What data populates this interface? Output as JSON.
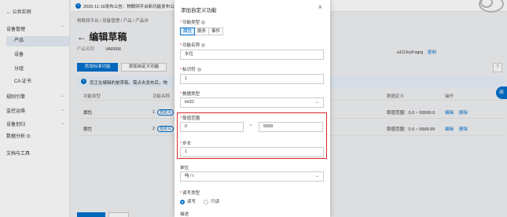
{
  "sidebar": {
    "back": "← 公共实例",
    "groups": [
      {
        "label": "设备管理",
        "items": [
          "产品",
          "设备",
          "分组",
          "CA 证书"
        ]
      },
      {
        "label": "规则引擎"
      },
      {
        "label": "监控运维"
      },
      {
        "label": "设备划归"
      },
      {
        "label": "数据分析 ⊡"
      },
      {
        "label": "文档与工具"
      }
    ]
  },
  "notice": {
    "icon": "info-icon",
    "text": "2020-11-19发布公告：物联网平台新功能发布公告，详情"
  },
  "breadcrumb": "物联网平台  /  设备管理  /  产品  /  产品详",
  "page_title": "← 编辑草稿",
  "meta": {
    "label": "产品名称",
    "value": "VAR666",
    "right_text": "a1OJoyFogrg",
    "right_link": "复制"
  },
  "buttons": {
    "add_std": "添加标准功能",
    "add_custom": "添加自定义功能"
  },
  "info_text": "您正在编辑的是草稿，需点击发布后，物",
  "table": {
    "headers": [
      "功能类型",
      "功能名称",
      "数据定义",
      "操作"
    ],
    "rows": [
      {
        "type": "属性",
        "name_prefix": "1",
        "tag": "自定义",
        "def": "取值范围：0.0 ~ 99999.0",
        "edit": "编辑",
        "delete": "删除"
      },
      {
        "type": "属性",
        "name_prefix": "2",
        "tag": "自定义",
        "def": "取值范围：0.0 ~ 9999.99",
        "edit": "编辑",
        "delete": "删除"
      }
    ]
  },
  "side_buttons": {
    "help": "?",
    "float": "⊞"
  },
  "dialog": {
    "title": "添加自定义功能",
    "close": "×",
    "fields": {
      "func_type": {
        "label": "功能类型",
        "options": [
          "属性",
          "服务",
          "事件"
        ],
        "selected": "属性"
      },
      "func_name": {
        "label": "功能名称",
        "value": "水位"
      },
      "identifier": {
        "label": "标识符",
        "value": "1"
      },
      "data_type": {
        "label": "数据类型",
        "value": "int32"
      },
      "range": {
        "label": "取值范围",
        "min": "0",
        "sep": "~",
        "max": "9999"
      },
      "step": {
        "label": "步长",
        "value": "1"
      },
      "unit": {
        "label": "单位",
        "value": "吨 / t"
      },
      "rw": {
        "label": "读写类型",
        "options": [
          "读写",
          "只读"
        ],
        "selected": "读写"
      },
      "desc": {
        "label": "描述"
      }
    }
  },
  "colors": {
    "primary": "#0070cc",
    "highlight": "#d62b2b",
    "required": "#d93026"
  }
}
